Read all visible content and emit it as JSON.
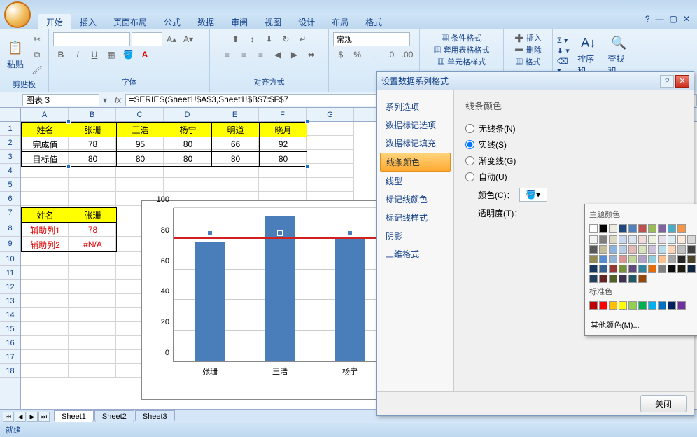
{
  "ribbon": {
    "tabs": [
      "开始",
      "插入",
      "页面布局",
      "公式",
      "数据",
      "审阅",
      "视图",
      "设计",
      "布局",
      "格式"
    ],
    "active_tab": "开始",
    "groups": {
      "clipboard": "剪贴板",
      "font": "字体",
      "alignment": "对齐方式",
      "paste": "粘贴"
    },
    "styles_items": [
      "条件格式",
      "套用表格格式",
      "单元格样式"
    ],
    "cells_items": [
      "插入",
      "删除",
      "格式"
    ],
    "edit_items": [
      "排序和",
      "查找和"
    ],
    "number_combo": "常规"
  },
  "namebox": "图表 3",
  "formula": "=SERIES(Sheet1!$A$3,Sheet1!$B$7:$F$7",
  "columns": [
    "A",
    "B",
    "C",
    "D",
    "E",
    "F",
    "G"
  ],
  "rows": [
    "1",
    "2",
    "3",
    "4",
    "5",
    "6",
    "7",
    "8",
    "9",
    "10",
    "11",
    "12",
    "13",
    "14",
    "15",
    "16",
    "17",
    "18"
  ],
  "table1": {
    "headers": [
      "姓名",
      "张珊",
      "王浩",
      "杨宁",
      "明道",
      "晓月"
    ],
    "row1_label": "完成值",
    "row1": [
      "78",
      "95",
      "80",
      "66",
      "92"
    ],
    "row2_label": "目标值",
    "row2": [
      "80",
      "80",
      "80",
      "80",
      "80"
    ]
  },
  "table2": {
    "h1": "姓名",
    "h2": "张珊",
    "r1a": "辅助列1",
    "r1b": "78",
    "r2a": "辅助列2",
    "r2b": "#N/A"
  },
  "chart_data": {
    "type": "bar",
    "categories": [
      "张珊",
      "王浩",
      "杨宁"
    ],
    "values": [
      78,
      95,
      80
    ],
    "target_line": 80,
    "ylim": [
      0,
      100
    ],
    "yticks": [
      0,
      20,
      40,
      60,
      80,
      100
    ],
    "title": "",
    "xlabel": "",
    "ylabel": ""
  },
  "dialog": {
    "title": "设置数据系列格式",
    "nav": [
      "系列选项",
      "数据标记选项",
      "数据标记填充",
      "线条颜色",
      "线型",
      "标记线颜色",
      "标记线样式",
      "阴影",
      "三维格式"
    ],
    "nav_active": "线条颜色",
    "heading": "线条颜色",
    "radios": [
      {
        "label": "无线条(N)",
        "key": "N",
        "checked": false
      },
      {
        "label": "实线(S)",
        "key": "S",
        "checked": true
      },
      {
        "label": "渐变线(G)",
        "key": "G",
        "checked": false
      },
      {
        "label": "自动(U)",
        "key": "U",
        "checked": false
      }
    ],
    "color_label": "颜色(C)：",
    "transparency_label": "透明度(T)：",
    "close_btn": "关闭"
  },
  "color_picker": {
    "theme_label": "主题颜色",
    "std_label": "标准色",
    "more_label": "其他颜色(M)...",
    "theme_row1": [
      "#ffffff",
      "#000000",
      "#eeece1",
      "#1f497d",
      "#4f81bd",
      "#c0504d",
      "#9bbb59",
      "#8064a2",
      "#4bacc6",
      "#f79646"
    ],
    "theme_shades": [
      [
        "#f2f2f2",
        "#7f7f7f",
        "#ddd9c3",
        "#c6d9f0",
        "#dbe5f1",
        "#f2dcdb",
        "#ebf1dd",
        "#e5e0ec",
        "#dbeef3",
        "#fdeada"
      ],
      [
        "#d8d8d8",
        "#595959",
        "#c4bd97",
        "#8db3e2",
        "#b8cce4",
        "#e5b9b7",
        "#d7e3bc",
        "#ccc1d9",
        "#b7dde8",
        "#fbd5b5"
      ],
      [
        "#bfbfbf",
        "#3f3f3f",
        "#938953",
        "#548dd4",
        "#95b3d7",
        "#d99694",
        "#c3d69b",
        "#b2a1c7",
        "#92cddc",
        "#fac08f"
      ],
      [
        "#a5a5a5",
        "#262626",
        "#494429",
        "#17365d",
        "#366092",
        "#953734",
        "#76923c",
        "#5f497a",
        "#31859b",
        "#e36c09"
      ],
      [
        "#7f7f7f",
        "#0c0c0c",
        "#1d1b10",
        "#0f243e",
        "#244061",
        "#632423",
        "#4f6128",
        "#3f3151",
        "#205867",
        "#974806"
      ]
    ],
    "standard": [
      "#c00000",
      "#ff0000",
      "#ffc000",
      "#ffff00",
      "#92d050",
      "#00b050",
      "#00b0f0",
      "#0070c0",
      "#002060",
      "#7030a0"
    ]
  },
  "sheets": [
    "Sheet1",
    "Sheet2",
    "Sheet3"
  ],
  "status": "就绪"
}
